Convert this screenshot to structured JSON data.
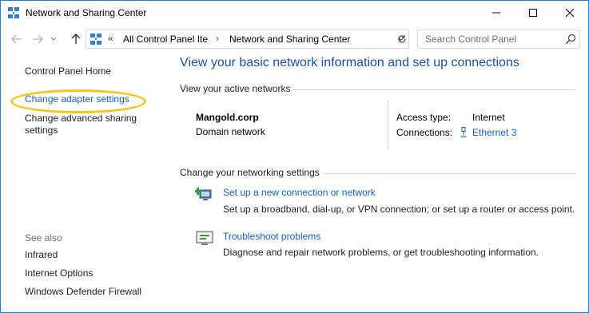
{
  "window": {
    "title": "Network and Sharing Center"
  },
  "address": {
    "sep": "«",
    "crumb1": "All Control Panel Ite",
    "crumb_arrow": "›",
    "crumb2": "Network and Sharing Center"
  },
  "search": {
    "placeholder": "Search Control Panel"
  },
  "sidebar": {
    "home": "Control Panel Home",
    "adapter": "Change adapter settings",
    "advanced": "Change advanced sharing settings",
    "see_also": "See also",
    "items": [
      "Infrared",
      "Internet Options",
      "Windows Defender Firewall"
    ]
  },
  "main": {
    "title": "View your basic network information and set up connections",
    "active_label": "View your active networks",
    "network": {
      "name": "Mangold.corp",
      "type": "Domain network",
      "access_label": "Access type:",
      "access_value": "Internet",
      "connections_label": "Connections:",
      "connections_value": "Ethernet 3"
    },
    "change_label": "Change your networking settings",
    "tasks": [
      {
        "link": "Set up a new connection or network",
        "desc": "Set up a broadband, dial-up, or VPN connection; or set up a router or access point."
      },
      {
        "link": "Troubleshoot problems",
        "desc": "Diagnose and repair network problems, or get troubleshooting information."
      }
    ]
  },
  "colors": {
    "link": "#1a5fb4",
    "title": "#1e4e9c",
    "highlight": "#f5c518",
    "border": "#2b79d8"
  }
}
